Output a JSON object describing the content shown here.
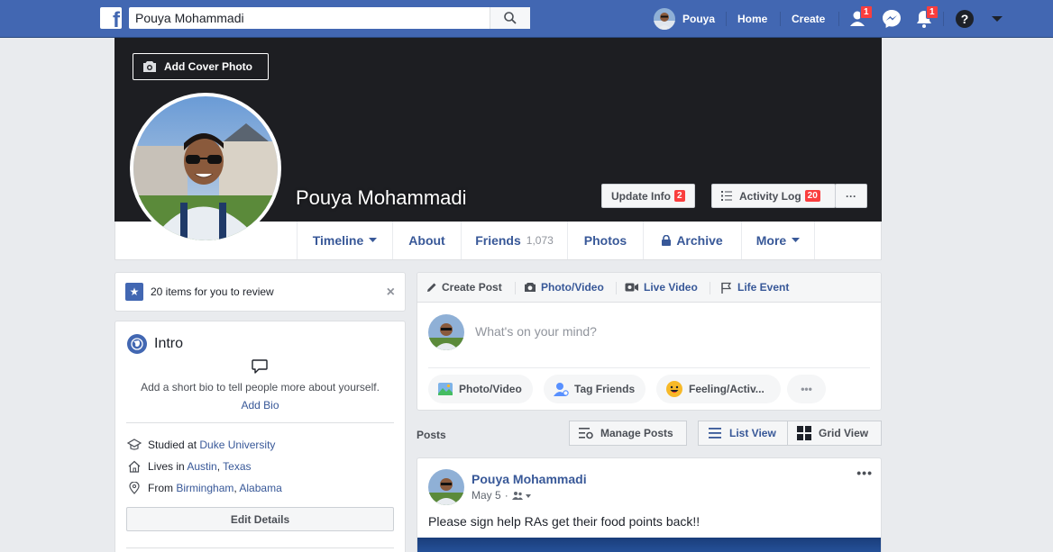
{
  "topbar": {
    "search_value": "Pouya Mohammadi",
    "user_name": "Pouya",
    "home_label": "Home",
    "create_label": "Create",
    "friend_requests_count": "1",
    "notifications_count": "1",
    "brand_color": "#4267b2"
  },
  "cover": {
    "add_cover_label": "Add Cover Photo",
    "profile_name": "Pouya Mohammadi",
    "update_info_label": "Update Info",
    "update_info_count": "2",
    "activity_log_label": "Activity Log",
    "activity_log_count": "20",
    "more_label": "···"
  },
  "profile_nav": {
    "tabs": [
      {
        "label": "Timeline"
      },
      {
        "label": "About"
      },
      {
        "label": "Friends",
        "sub": "1,073"
      },
      {
        "label": "Photos"
      },
      {
        "label": "Archive"
      },
      {
        "label": "More"
      }
    ]
  },
  "review": {
    "text": "20 items for you to review",
    "close": "×"
  },
  "intro": {
    "title": "Intro",
    "bio_prompt": "Add a short bio to tell people more about yourself.",
    "add_bio": "Add Bio",
    "studied_prefix": "Studied at",
    "studied_at": "Duke University",
    "lives_prefix": "Lives in",
    "lives_city": "Austin",
    "lives_state": "Texas",
    "from_prefix": "From",
    "from_city": "Birmingham",
    "from_state": "Alabama",
    "edit_details": "Edit Details"
  },
  "composer": {
    "tabs": [
      "Create Post",
      "Photo/Video",
      "Live Video",
      "Life Event"
    ],
    "placeholder": "What's on your mind?",
    "actions": [
      "Photo/Video",
      "Tag Friends",
      "Feeling/Activ..."
    ],
    "more": "•••"
  },
  "posts": {
    "label": "Posts",
    "manage": "Manage Posts",
    "list_view": "List View",
    "grid_view": "Grid View"
  },
  "post": {
    "author": "Pouya Mohammadi",
    "date": "May 5",
    "dot": "·",
    "text": "Please sign help RAs get their food points back!!",
    "more": "•••"
  }
}
